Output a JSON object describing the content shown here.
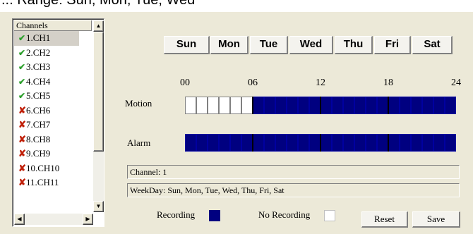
{
  "top_fragment": "... Range: Sun, Mon, Tue, Wed",
  "channels": {
    "header": "Channels",
    "items": [
      {
        "label": "1.CH1",
        "status": "on"
      },
      {
        "label": "2.CH2",
        "status": "on"
      },
      {
        "label": "3.CH3",
        "status": "on"
      },
      {
        "label": "4.CH4",
        "status": "on"
      },
      {
        "label": "5.CH5",
        "status": "on"
      },
      {
        "label": "6.CH6",
        "status": "off"
      },
      {
        "label": "7.CH7",
        "status": "off"
      },
      {
        "label": "8.CH8",
        "status": "off"
      },
      {
        "label": "9.CH9",
        "status": "off"
      },
      {
        "label": "10.CH10",
        "status": "off"
      },
      {
        "label": "11.CH11",
        "status": "off"
      }
    ],
    "icons": {
      "on": "check-icon",
      "off": "cross-icon"
    }
  },
  "days": [
    "Sun",
    "Mon",
    "Tue",
    "Wed",
    "Thu",
    "Fri",
    "Sat"
  ],
  "hours": [
    "00",
    "06",
    "12",
    "18",
    "24"
  ],
  "motion": {
    "label": "Motion",
    "slots": [
      0,
      0,
      0,
      0,
      0,
      0,
      1,
      1,
      1,
      1,
      1,
      1,
      1,
      1,
      1,
      1,
      1,
      1,
      1,
      1,
      1,
      1,
      1,
      1
    ]
  },
  "alarm": {
    "label": "Alarm",
    "slots": [
      1,
      1,
      1,
      1,
      1,
      1,
      1,
      1,
      1,
      1,
      1,
      1,
      1,
      1,
      1,
      1,
      1,
      1,
      1,
      1,
      1,
      1,
      1,
      1
    ]
  },
  "info": {
    "channel": "Channel: 1",
    "weekday": "WeekDay: Sun, Mon, Tue, Wed, Thu, Fri, Sat"
  },
  "legend": {
    "recording": "Recording",
    "no_recording": "No Recording",
    "recording_color": "#000080",
    "no_recording_color": "#ffffff"
  },
  "buttons": {
    "reset": "Reset",
    "save": "Save"
  }
}
